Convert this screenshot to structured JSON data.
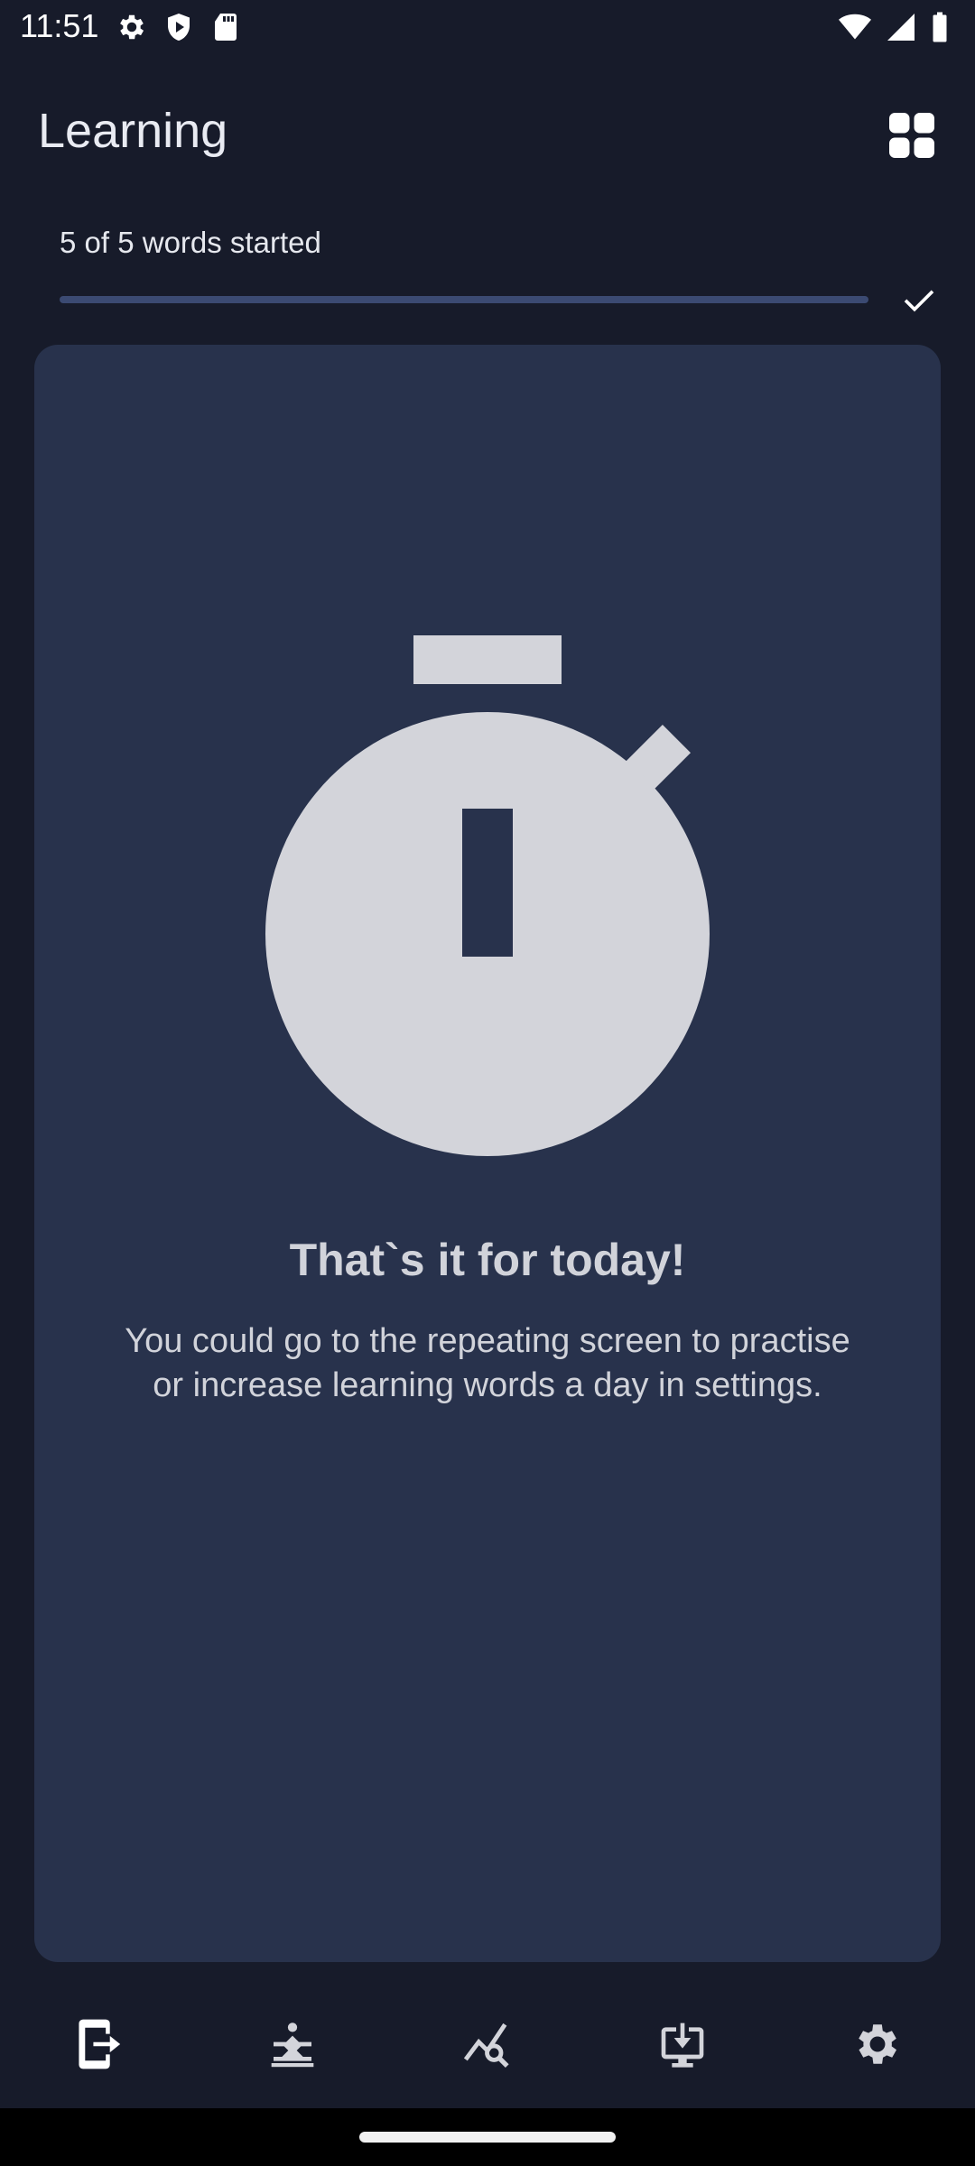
{
  "status_bar": {
    "time": "11:51",
    "left_icons": [
      "settings-icon",
      "shield-play-icon",
      "sd-card-icon"
    ],
    "right_icons": [
      "wifi-icon",
      "signal-icon",
      "battery-icon"
    ]
  },
  "app_bar": {
    "title": "Learning",
    "action_icon": "grid-view-icon"
  },
  "progress": {
    "label": "5 of 5 words started",
    "fraction": 1.0,
    "complete_icon": "check-icon"
  },
  "card": {
    "icon": "timer-icon",
    "title": "That`s it for today!",
    "description": "You could go to the repeating screen to practise or increase learning words a day in settings."
  },
  "bottom_nav": {
    "items": [
      {
        "icon": "learning-exit-icon",
        "selected": true
      },
      {
        "icon": "practice-pose-icon",
        "selected": false
      },
      {
        "icon": "analytics-search-icon",
        "selected": false
      },
      {
        "icon": "download-to-device-icon",
        "selected": false
      },
      {
        "icon": "settings-icon",
        "selected": false
      }
    ]
  },
  "colors": {
    "background": "#171b2a",
    "card": "#28324c",
    "progress_fill": "#3b4a72",
    "icon_light": "#d3d4da",
    "text": "#e6e8ee"
  }
}
